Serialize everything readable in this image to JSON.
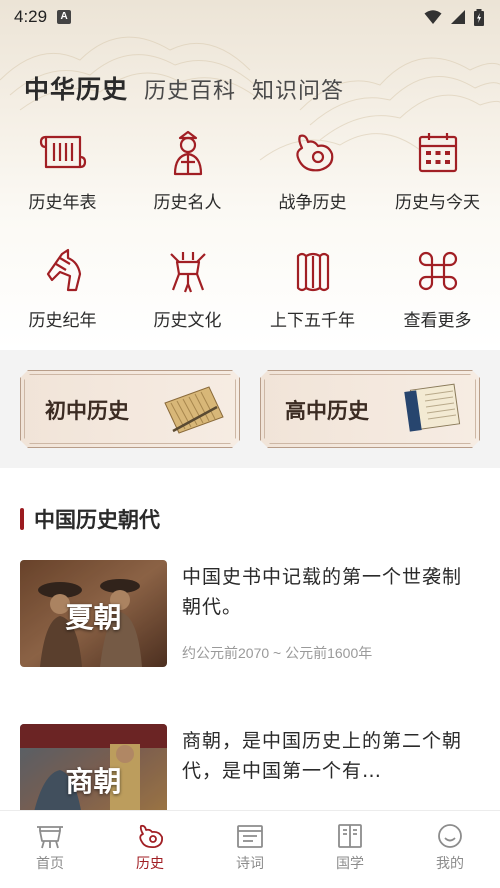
{
  "status": {
    "time": "4:29",
    "notif": "A"
  },
  "header": {
    "tabs": [
      {
        "label": "中华历史",
        "active": true
      },
      {
        "label": "历史百科",
        "active": false
      },
      {
        "label": "知识问答",
        "active": false
      }
    ]
  },
  "grid": [
    {
      "label": "历史年表",
      "icon": "scroll-icon"
    },
    {
      "label": "历史名人",
      "icon": "scholar-icon"
    },
    {
      "label": "战争历史",
      "icon": "war-icon"
    },
    {
      "label": "历史与今天",
      "icon": "calendar-icon"
    },
    {
      "label": "历史纪年",
      "icon": "horse-icon"
    },
    {
      "label": "历史文化",
      "icon": "bronze-vessel-icon"
    },
    {
      "label": "上下五千年",
      "icon": "bamboo-book-icon"
    },
    {
      "label": "查看更多",
      "icon": "more-icon"
    }
  ],
  "cards": [
    {
      "label": "初中历史",
      "art": "bamboo-scroll-art"
    },
    {
      "label": "高中历史",
      "art": "book-scroll-art"
    }
  ],
  "section": {
    "title": "中国历史朝代"
  },
  "dynasties": [
    {
      "name": "夏朝",
      "desc": "中国史书中记载的第一个世袭制朝代。",
      "period": "约公元前2070 ~ 公元前1600年"
    },
    {
      "name": "商朝",
      "desc": "商朝，是中国历史上的第二个朝代，是中国第一个有…",
      "period": ""
    }
  ],
  "nav": [
    {
      "label": "首页",
      "icon": "home-tripod-icon",
      "active": false
    },
    {
      "label": "历史",
      "icon": "history-icon",
      "active": true
    },
    {
      "label": "诗词",
      "icon": "poetry-icon",
      "active": false
    },
    {
      "label": "国学",
      "icon": "classics-icon",
      "active": false
    },
    {
      "label": "我的",
      "icon": "profile-icon",
      "active": false
    }
  ],
  "colors": {
    "accent": "#a11f24",
    "section_bar": "#9b1b20",
    "card_bg": "#f1e4d8"
  }
}
